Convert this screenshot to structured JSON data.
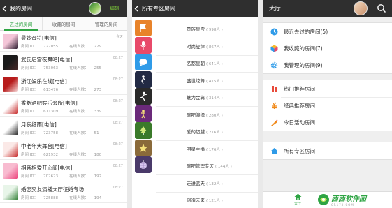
{
  "panel1": {
    "title": "我的房间",
    "edit_label": "编辑",
    "tabs": [
      {
        "label": "去过的房间",
        "active": true
      },
      {
        "label": "收藏的房间",
        "active": false
      },
      {
        "label": "管理的房间",
        "active": false
      }
    ],
    "id_prefix": "房间 ID：",
    "online_prefix": "在线人数：",
    "rooms": [
      {
        "name": "曼妙音符[电信]",
        "id": "722055",
        "online": "229",
        "time": "今天",
        "colors": [
          "#f4c6d8",
          "#2a1a2e"
        ]
      },
      {
        "name": "武氏后宫夜舞吧[电信]",
        "id": "753063",
        "online": "255",
        "time": "08:27",
        "colors": [
          "#1b1b1b",
          "#4a2a2a"
        ]
      },
      {
        "name": "浙江娱乐在线[电信]",
        "id": "613476",
        "online": "273",
        "time": "08:27",
        "colors": [
          "#b71c1c",
          "#f8e1e1"
        ]
      },
      {
        "name": "香烟酒吧娱乐会所[电信]",
        "id": "611309",
        "online": "339",
        "time": "08:27",
        "colors": [
          "#ffffff",
          "#c62828"
        ]
      },
      {
        "name": "月夜细雨[电信]",
        "id": "723758",
        "online": "51",
        "time": "08:27",
        "colors": [
          "#ffffff",
          "#222222"
        ]
      },
      {
        "name": "中老年大舞台[电信]",
        "id": "621932",
        "online": "180",
        "time": "08:27",
        "colors": [
          "#fbe9e7",
          "#c62828"
        ]
      },
      {
        "name": "相亲相爱开心阁[电信]",
        "id": "702623",
        "online": "192",
        "time": "08:27",
        "colors": [
          "#f8bbd0",
          "#ec407a"
        ]
      },
      {
        "name": "婚恋交友演播大厅征婚专场",
        "id": "725888",
        "online": "194",
        "time": "08:27",
        "colors": [
          "#e8f5e9",
          "#2e7d32"
        ]
      }
    ]
  },
  "panel2": {
    "title": "所有专区房间",
    "zones": [
      {
        "name": "贵族皇宫",
        "count": "( 998人 )",
        "icon": "flag-icon",
        "color": "#e8832a"
      },
      {
        "name": "时尚旋律",
        "count": "( 867人 )",
        "icon": "microphone-icon",
        "color": "#e84a6a"
      },
      {
        "name": "名都皇朝",
        "count": "( 641人 )",
        "icon": "chat-bubble-icon",
        "color": "#2f9be8"
      },
      {
        "name": "盛世炫舞",
        "count": "( 415人 )",
        "icon": "singer-icon",
        "color": "#222a44"
      },
      {
        "name": "魅力金典",
        "count": "( 314人 )",
        "icon": "dancer-icon",
        "color": "#2a2a2a"
      },
      {
        "name": "聊吧演绎",
        "count": "( 280人 )",
        "icon": "performer-icon",
        "color": "#6b2a7a"
      },
      {
        "name": "爱的超越",
        "count": "( 216人 )",
        "icon": "tree-icon",
        "color": "#3a7a2a"
      },
      {
        "name": "明星主播",
        "count": "( 176人 )",
        "icon": "star-icon",
        "color": "#8a6a3a"
      },
      {
        "name": "聊吧管理专区",
        "count": "( 144人 )",
        "icon": "disco-ball-icon",
        "color": "#4a3a6a"
      },
      {
        "name": "走进蓝天",
        "count": "( 132人 )",
        "icon": "",
        "color": "#ffffff"
      },
      {
        "name": "创造未来",
        "count": "( 121人 )",
        "icon": "",
        "color": "#ffffff"
      }
    ]
  },
  "panel3": {
    "title": "大厅",
    "group1": [
      {
        "label": "最近去过的房间(5)",
        "icon": "clock-icon"
      },
      {
        "label": "我收藏的房间(7)",
        "icon": "cube-icon"
      },
      {
        "label": "我管理的房间(9)",
        "icon": "gear-icon"
      }
    ],
    "group2": [
      {
        "label": "热门推荐房间",
        "icon": "hot-icon"
      },
      {
        "label": "经典推荐房间",
        "icon": "classic-icon"
      },
      {
        "label": "今日活动房间",
        "icon": "activity-icon"
      }
    ],
    "group3": [
      {
        "label": "所有专区房间",
        "icon": "home-zone-icon"
      }
    ],
    "bottom_tab": "大厅",
    "watermark_main": "西西软件园",
    "watermark_sub": "CR173.COM"
  },
  "colors": {
    "accent": "#2ea443",
    "topbar": "#2f2f2f",
    "edit": "#7ecb3a"
  }
}
